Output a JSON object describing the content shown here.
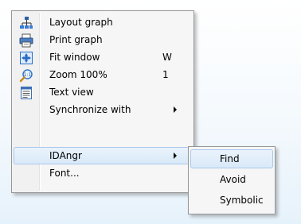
{
  "context_menu": {
    "items": [
      {
        "label": "Layout graph",
        "icon": "layout-graph-icon"
      },
      {
        "label": "Print graph",
        "icon": "printer-icon"
      },
      {
        "label": "Fit window",
        "shortcut": "W",
        "icon": "fit-window-icon"
      },
      {
        "label": "Zoom 100%",
        "shortcut": "1",
        "icon": "zoom-icon"
      },
      {
        "label": "Text view",
        "icon": "text-view-icon"
      },
      {
        "label": "Synchronize with",
        "has_submenu": true
      },
      {
        "label": "IDAngr",
        "has_submenu": true,
        "highlighted": true
      },
      {
        "label": "Font..."
      }
    ]
  },
  "submenu": {
    "parent": "IDAngr",
    "items": [
      {
        "label": "Find",
        "highlighted": true
      },
      {
        "label": "Avoid"
      },
      {
        "label": "Symbolic"
      }
    ]
  },
  "colors": {
    "menu_background": "#f6f6f6",
    "highlight_fill": "#d9e9f8",
    "highlight_border": "#a8c8ea"
  }
}
